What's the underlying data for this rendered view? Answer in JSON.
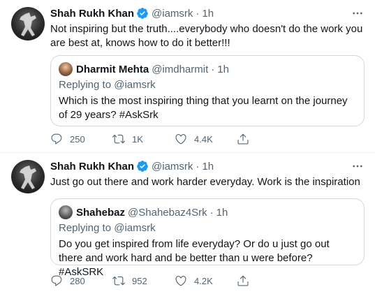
{
  "tweets": [
    {
      "author": {
        "name": "Shah Rukh Khan",
        "handle": "@iamsrk"
      },
      "separator": "·",
      "time": "1h",
      "text": "Not inspiring but the truth....everybody who doesn't do the work you are best at, knows how to do it better!!!",
      "quote": {
        "author": {
          "name": "Dharmit Mehta",
          "handle": "@imdharmit"
        },
        "separator": "·",
        "time": "1h",
        "replying_prefix": "Replying to",
        "replying_to": "@iamsrk",
        "text": "Which is the most inspiring thing that you learnt on the journey of 29 years? #AskSrk"
      },
      "stats": {
        "replies": "250",
        "retweets": "1K",
        "likes": "4.4K"
      }
    },
    {
      "author": {
        "name": "Shah Rukh Khan",
        "handle": "@iamsrk"
      },
      "separator": "·",
      "time": "1h",
      "text": "Just go out there and work harder everyday. Work is the inspiration",
      "quote": {
        "author": {
          "name": "Shahebaz",
          "handle": "@Shahebaz4Srk"
        },
        "separator": "·",
        "time": "1h",
        "replying_prefix": "Replying to",
        "replying_to": "@iamsrk",
        "text": "Do you get inspired from life everyday? Or do u just go out there and work hard and be better than u were before? #AskSRK"
      },
      "stats": {
        "replies": "280",
        "retweets": "952",
        "likes": "4.2K"
      }
    }
  ],
  "icons": {
    "verified": "verified-badge-icon",
    "more": "more-options-icon",
    "reply": "reply-icon",
    "retweet": "retweet-icon",
    "like": "like-icon",
    "share": "share-icon"
  },
  "colors": {
    "verified_blue": "#1d9bf0",
    "secondary_text": "#536471",
    "primary_text": "#0f1419",
    "border": "#cfd9de"
  }
}
